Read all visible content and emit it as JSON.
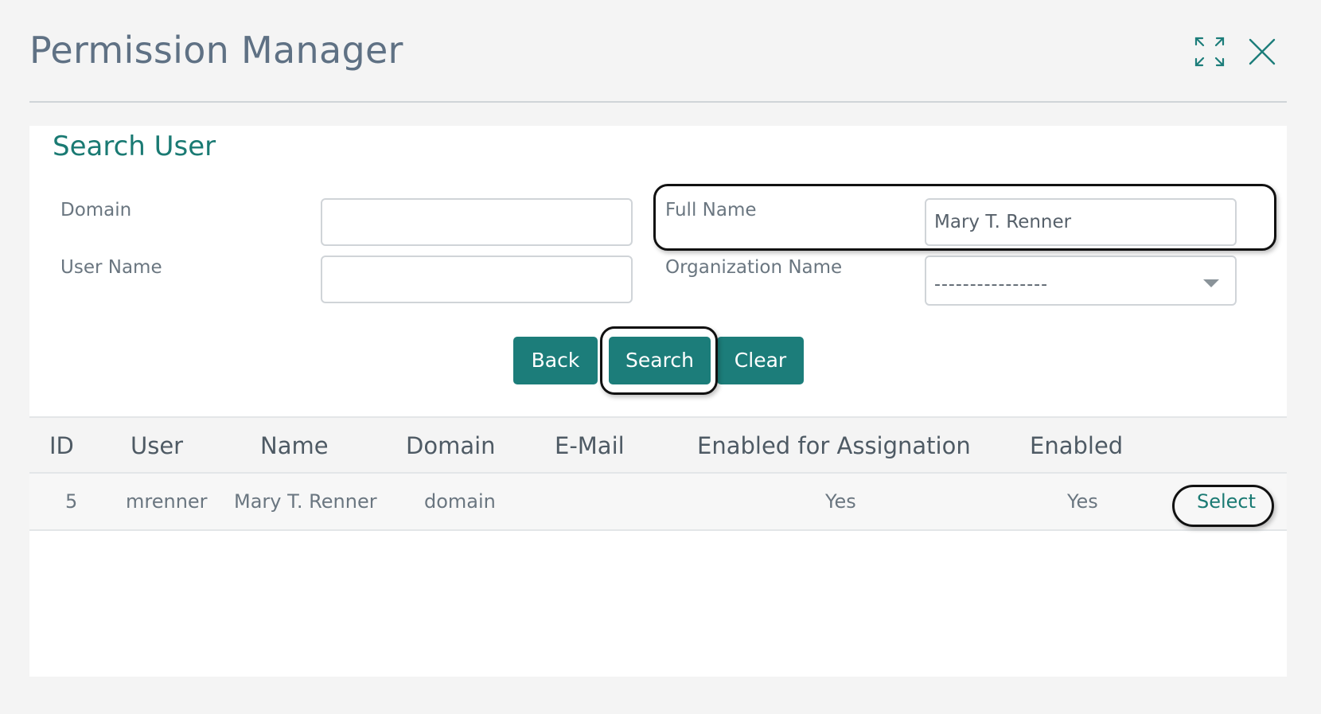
{
  "window": {
    "title": "Permission Manager",
    "expand_icon": "expand-icon",
    "close_icon": "close-icon"
  },
  "search": {
    "title": "Search User",
    "fields": {
      "domain": {
        "label": "Domain",
        "value": ""
      },
      "user_name": {
        "label": "User Name",
        "value": ""
      },
      "full_name": {
        "label": "Full Name",
        "value": "Mary T. Renner"
      },
      "organization_name": {
        "label": "Organization Name",
        "value": "----------------"
      }
    },
    "buttons": {
      "back": "Back",
      "search": "Search",
      "clear": "Clear"
    }
  },
  "table": {
    "columns": [
      "ID",
      "User",
      "Name",
      "Domain",
      "E-Mail",
      "Enabled for Assignation",
      "Enabled"
    ],
    "rows": [
      {
        "id": "5",
        "user": "mrenner",
        "name": "Mary T. Renner",
        "domain": "domain",
        "email": "",
        "enabled_for_assignation": "Yes",
        "enabled": "Yes",
        "action": "Select"
      }
    ]
  },
  "colors": {
    "accent": "#1c7d7a",
    "title_text": "#5f7184",
    "section_title": "#1a7a73",
    "background": "#f4f4f4"
  }
}
